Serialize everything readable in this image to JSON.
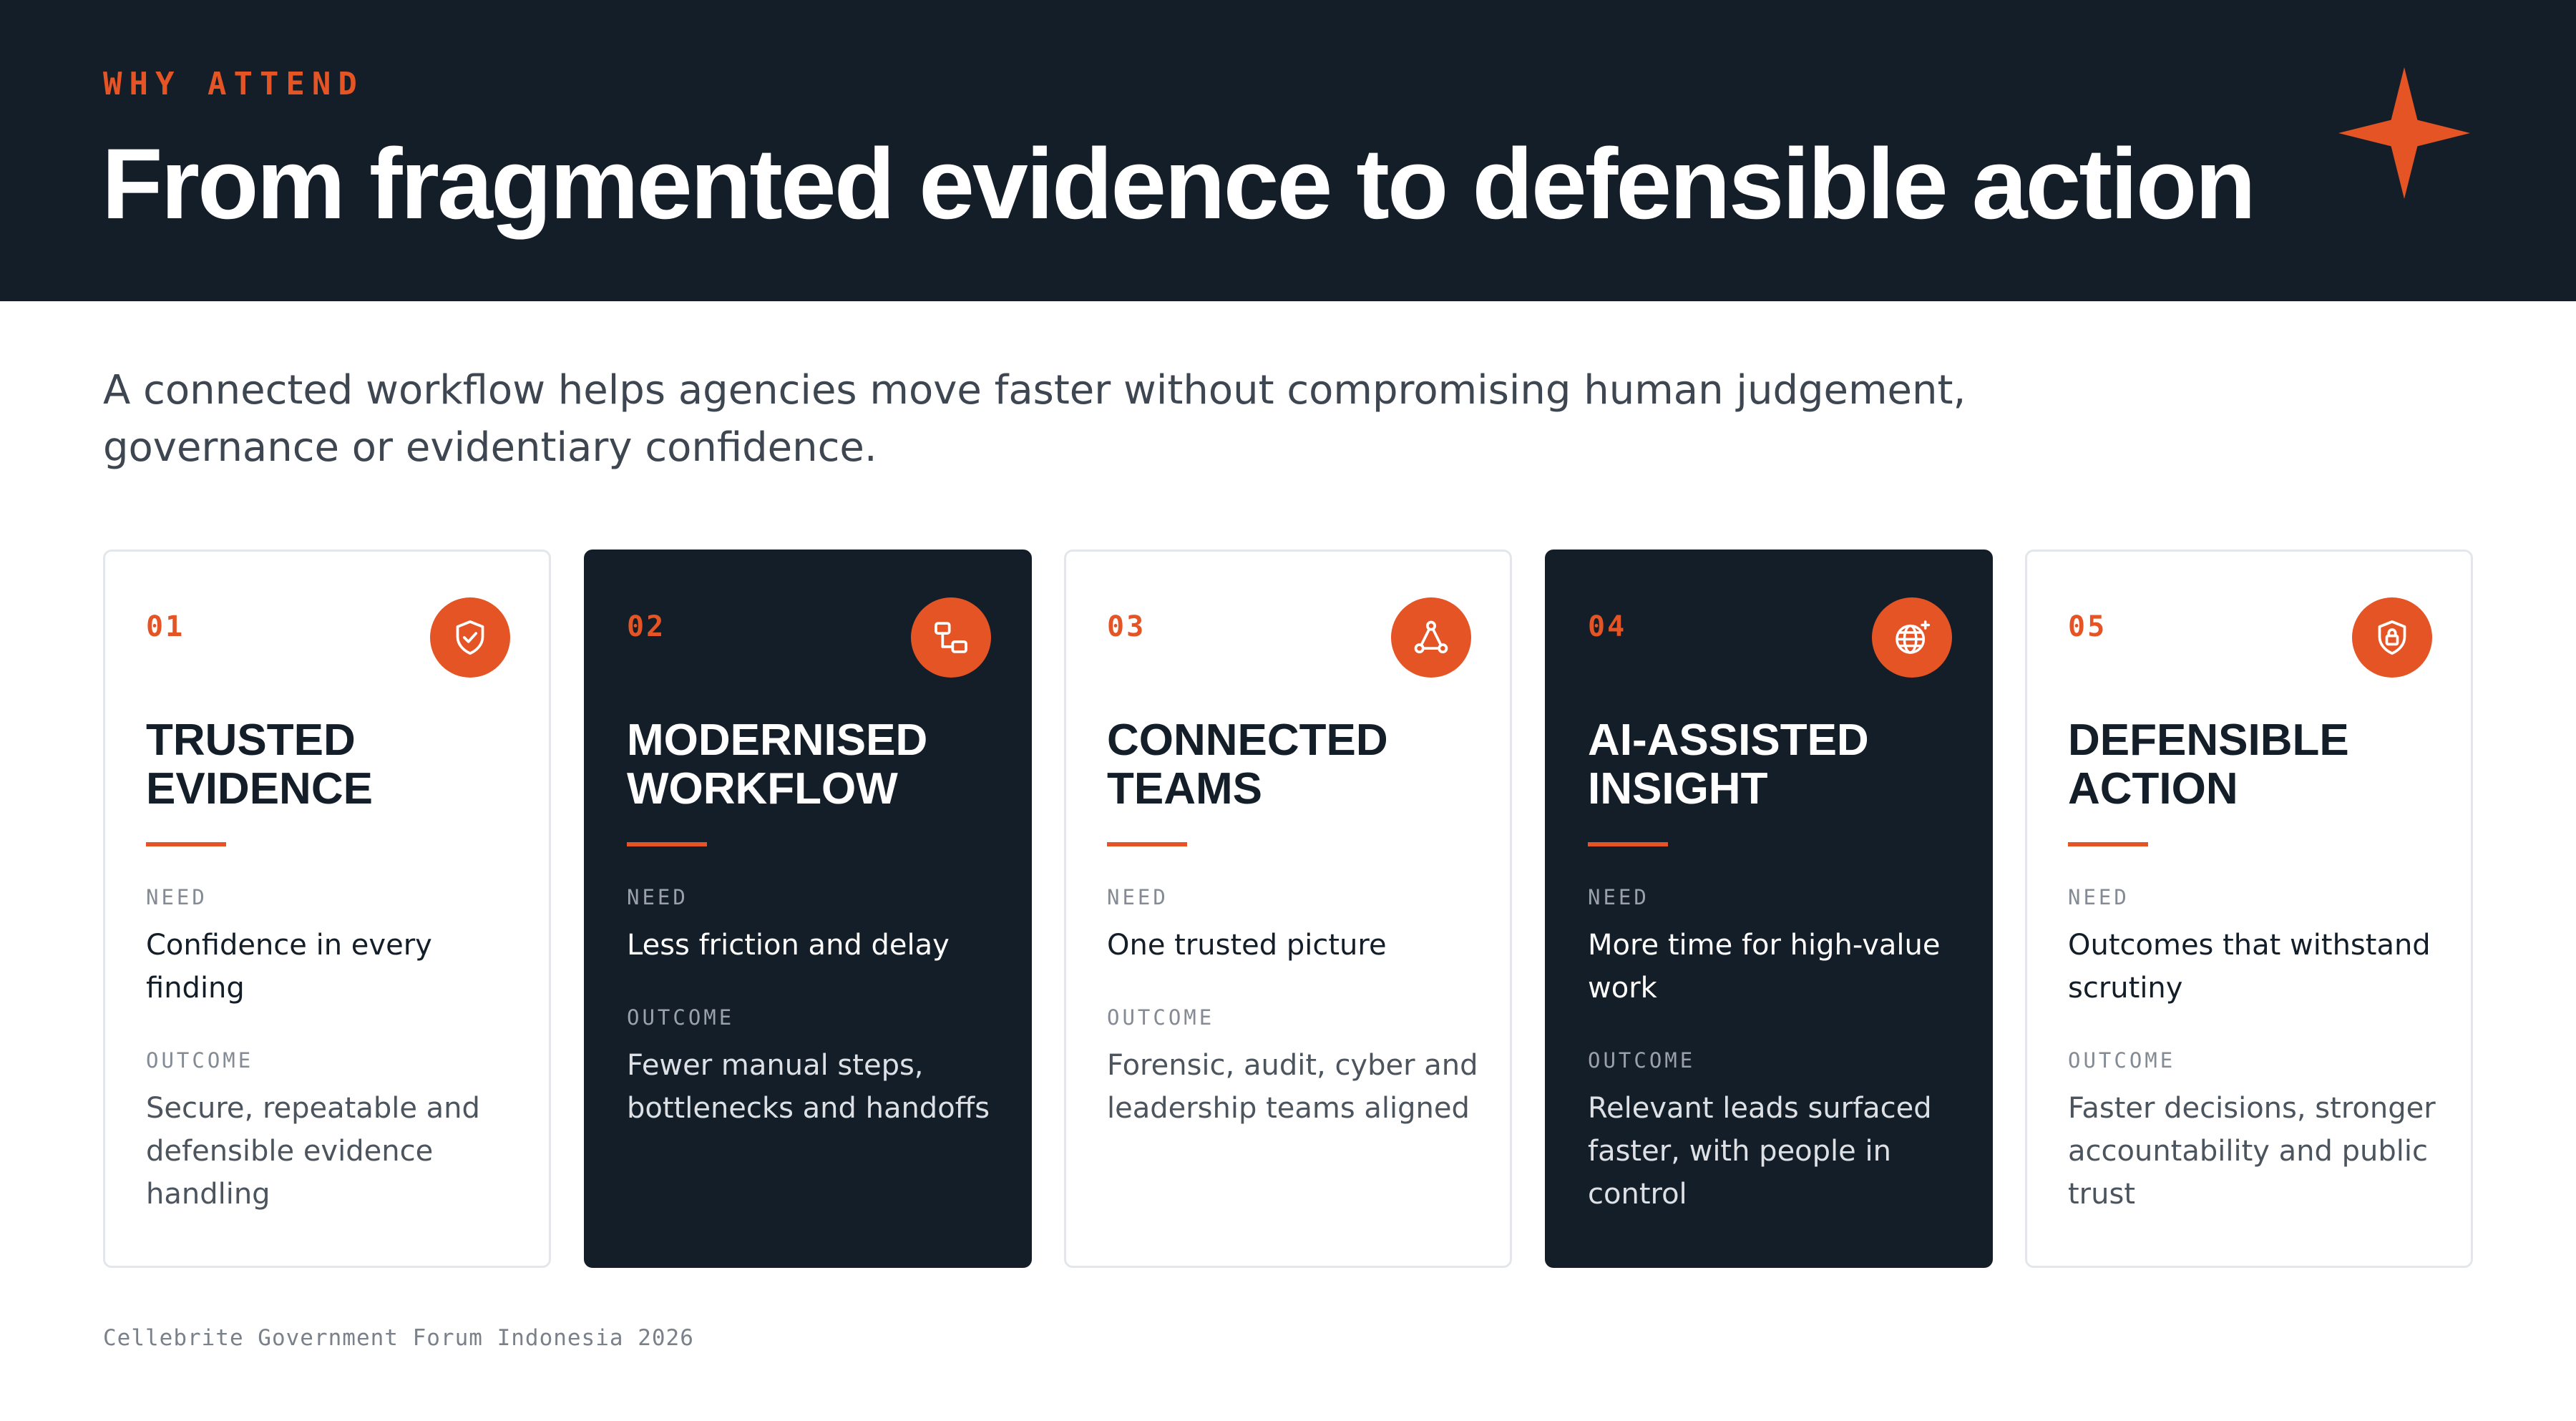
{
  "header": {
    "eyebrow": "WHY ATTEND",
    "title": "From fragmented evidence to defensible action",
    "accent_color": "#e55424",
    "background_color": "#141e28",
    "decoration_icon": "four-point-star-icon"
  },
  "subtitle": "A connected workflow helps agencies move faster without compromising human judgement, governance or evidentiary confidence.",
  "cards": [
    {
      "number": "01",
      "icon": "shield-check-icon",
      "title_line1": "TRUSTED",
      "title_line2": "EVIDENCE",
      "need_label": "NEED",
      "need": "Confidence in every finding",
      "outcome_label": "OUTCOME",
      "outcome": "Secure, repeatable and defensible evidence handling",
      "theme": "light"
    },
    {
      "number": "02",
      "icon": "workflow-blocks-icon",
      "title_line1": "MODERNISED",
      "title_line2": "WORKFLOW",
      "need_label": "NEED",
      "need": "Less friction and delay",
      "outcome_label": "OUTCOME",
      "outcome": "Fewer manual steps, bottlenecks and handoffs",
      "theme": "dark"
    },
    {
      "number": "03",
      "icon": "network-triangle-icon",
      "title_line1": "CONNECTED",
      "title_line2": "TEAMS",
      "need_label": "NEED",
      "need": "One trusted picture",
      "outcome_label": "OUTCOME",
      "outcome": "Forensic, audit, cyber and leadership teams aligned",
      "theme": "light"
    },
    {
      "number": "04",
      "icon": "globe-sparkle-icon",
      "title_line1": "AI-ASSISTED",
      "title_line2": "INSIGHT",
      "need_label": "NEED",
      "need": "More time for high-value work",
      "outcome_label": "OUTCOME",
      "outcome": "Relevant leads surfaced faster, with people in control",
      "theme": "dark"
    },
    {
      "number": "05",
      "icon": "shield-lock-icon",
      "title_line1": "DEFENSIBLE",
      "title_line2": "ACTION",
      "need_label": "NEED",
      "need": "Outcomes that withstand scrutiny",
      "outcome_label": "OUTCOME",
      "outcome": "Faster decisions, stronger accountability and public trust",
      "theme": "light"
    }
  ],
  "footer": "Cellebrite Government Forum Indonesia 2026"
}
